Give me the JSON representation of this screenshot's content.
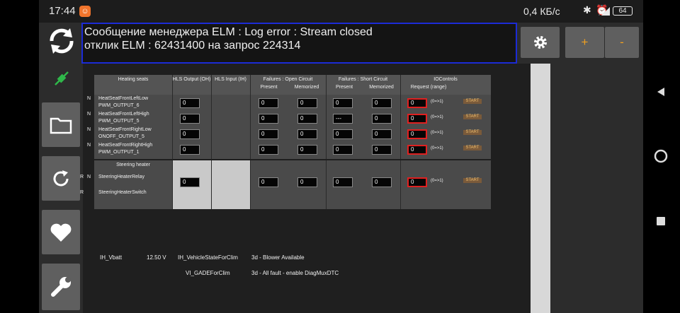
{
  "status": {
    "time": "17:44",
    "speed": "0,4 КБ/с",
    "battery": "64"
  },
  "message": {
    "line1": "Сообщение менеджера ELM : Log error : Stream closed",
    "line2": "отклик ELM : 62431400 на запрос 224314"
  },
  "top_buttons": {
    "plus": "+",
    "minus": "-"
  },
  "headers": {
    "heating_seats": "Heating seats",
    "hls_output": "HLS Output (OH)",
    "hls_input": "HLS Input (IH)",
    "failures_open": "Failures : Open Circuit",
    "failures_short": "Failures : Short Circuit",
    "iocontrols": "IOControls",
    "present": "Present",
    "memorized": "Memorized",
    "request": "Request (range)"
  },
  "rows": [
    {
      "flag": "N",
      "line1": "HeatSeatFrontLeftLow",
      "line2": "PWM_OUTPUT_6",
      "hls": "0",
      "op": "0",
      "om": "0",
      "sp": "0",
      "sm": "0",
      "req": "0",
      "range": "(0=>1)",
      "start": "START"
    },
    {
      "flag": "N",
      "line1": "HeatSeatFrontLeftHigh",
      "line2": "PWM_OUTPUT_5",
      "hls": "0",
      "op": "0",
      "om": "0",
      "sp": "---",
      "sm": "0",
      "req": "0",
      "range": "(0=>1)",
      "start": "START"
    },
    {
      "flag": "N",
      "line1": "HeatSeatFrontRightLow",
      "line2": "ONOFF_OUTPUT_5",
      "hls": "0",
      "op": "0",
      "om": "0",
      "sp": "0",
      "sm": "0",
      "req": "0",
      "range": "(0=>1)",
      "start": "START"
    },
    {
      "flag": "N",
      "line1": "HeatSeatFrontRightHigh",
      "line2": "PWM_OUTPUT_1",
      "hls": "0",
      "op": "0",
      "om": "0",
      "sp": "0",
      "sm": "0",
      "req": "0",
      "range": "(0=>1)",
      "start": "START"
    }
  ],
  "steering": {
    "title": "Steering heater",
    "relay": {
      "flag1": "R",
      "flag2": "N",
      "label": "SteeringHeaterRelay",
      "hls": "0",
      "op": "0",
      "om": "0",
      "sp": "0",
      "sm": "0",
      "req": "0",
      "range": "(0=>1)",
      "start": "START"
    },
    "switch": {
      "flag1": "R",
      "label": "SteeringHeaterSwitch"
    }
  },
  "bottom": {
    "vbatt_label": "IH_Vbatt",
    "vbatt_value": "12.50 V",
    "vehicle_state_label": "IH_VehicleStateForClim",
    "vehicle_state_value": "3d - Blower Available",
    "gade_label": "VI_GADEForClim",
    "gade_value": "3d - All fault - enable DiagMuxDTC"
  },
  "colors": {
    "accent": "#f0a020",
    "frame": "#1c2bd6",
    "alert": "#e02020",
    "plug": "#2fb84a"
  }
}
